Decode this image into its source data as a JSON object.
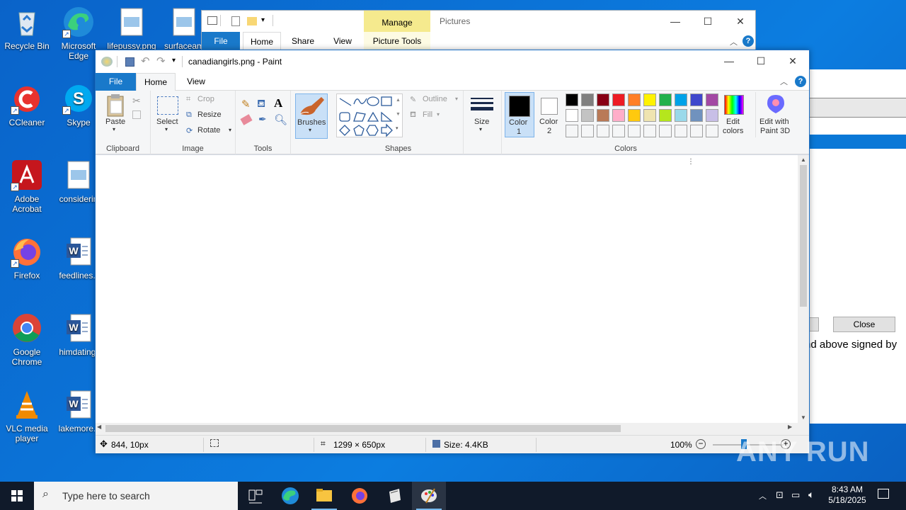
{
  "desktop": {
    "icons": [
      {
        "label": "Recycle Bin"
      },
      {
        "label": "Microsoft Edge"
      },
      {
        "label": "lifepussy.png"
      },
      {
        "label": "surfaceam"
      },
      {
        "label": "CCleaner"
      },
      {
        "label": "Skype"
      },
      {
        "label": "Adobe Acrobat"
      },
      {
        "label": "considerin"
      },
      {
        "label": "Firefox"
      },
      {
        "label": "feedlines.r"
      },
      {
        "label": "Google Chrome"
      },
      {
        "label": "himdating."
      },
      {
        "label": "VLC media player"
      },
      {
        "label": "lakemore.r"
      }
    ]
  },
  "explorer": {
    "manage_label": "Manage",
    "context_title": "Pictures",
    "tabs": [
      "File",
      "Home",
      "Share",
      "View",
      "Picture Tools"
    ]
  },
  "background_window": {
    "close_button": "Close",
    "text_fragment": "nd above signed by"
  },
  "paint": {
    "title": "canadiangirls.png - Paint",
    "tabs": {
      "file": "File",
      "home": "Home",
      "view": "View"
    },
    "clipboard": {
      "paste": "Paste",
      "group": "Clipboard"
    },
    "image": {
      "select": "Select",
      "crop": "Crop",
      "resize": "Resize",
      "rotate": "Rotate",
      "group": "Image"
    },
    "tools": {
      "group": "Tools"
    },
    "brushes": {
      "label": "Brushes"
    },
    "shapes": {
      "outline": "Outline",
      "fill": "Fill",
      "group": "Shapes"
    },
    "size": {
      "label": "Size"
    },
    "colors": {
      "color1": "Color\n1",
      "color1_a": "Color",
      "color1_b": "1",
      "color2_a": "Color",
      "color2_b": "2",
      "edit_colors_a": "Edit",
      "edit_colors_b": "colors",
      "group": "Colors",
      "palette_row1": [
        "#000000",
        "#7f7f7f",
        "#880015",
        "#ed1c24",
        "#ff7f27",
        "#fff200",
        "#22b14c",
        "#00a2e8",
        "#3f48cc",
        "#a349a4"
      ],
      "palette_row2": [
        "#ffffff",
        "#c3c3c3",
        "#b97a57",
        "#ffaec9",
        "#ffc90e",
        "#efe4b0",
        "#b5e61d",
        "#99d9ea",
        "#7092be",
        "#c8bfe7"
      ]
    },
    "paint3d": {
      "line1": "Edit with",
      "line2": "Paint 3D"
    },
    "status": {
      "cursor_pos": "844, 10px",
      "dimensions": "1299 × 650px",
      "size": "Size: 4.4KB",
      "zoom": "100%"
    }
  },
  "taskbar": {
    "search_placeholder": "Type here to search",
    "time": "8:43 AM",
    "date": "5/18/2025"
  },
  "watermark": "ANY RUN"
}
